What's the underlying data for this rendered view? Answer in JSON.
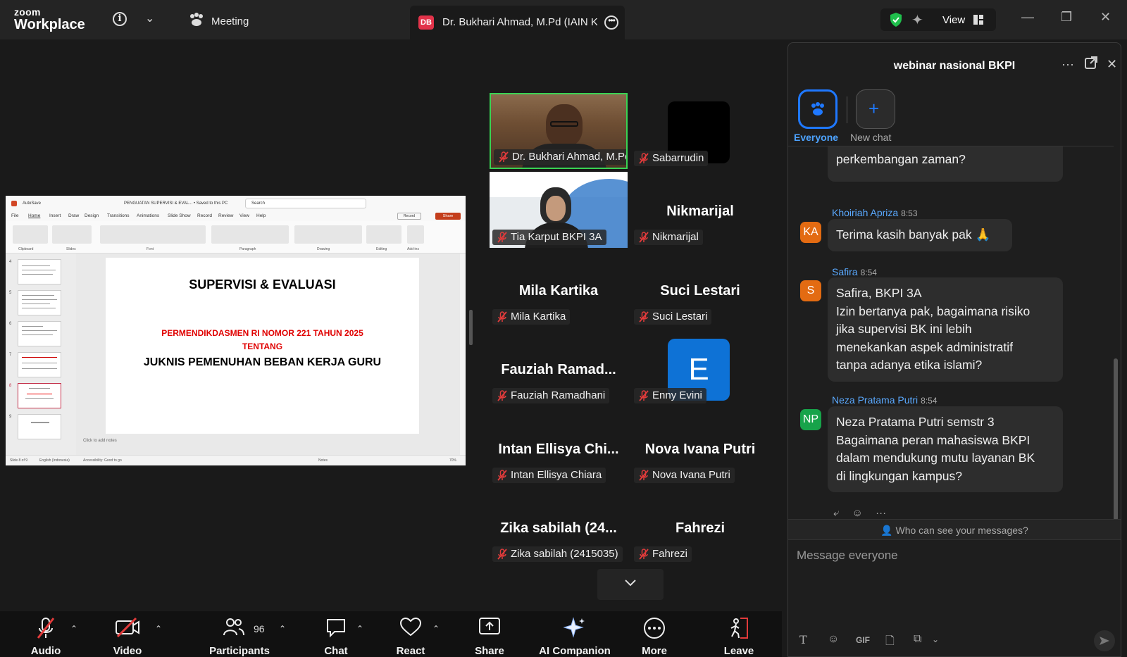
{
  "app": {
    "brand_top": "zoom",
    "brand_bottom": "Workplace",
    "meeting_label": "Meeting",
    "view_label": "View"
  },
  "active_tab": {
    "initials": "DB",
    "title": "Dr. Bukhari Ahmad, M.Pd (IAIN Ke"
  },
  "shared_screen": {
    "autosave": "AutoSave",
    "doc_title": "PENGUATAN SUPERVISI & EVAL... • Saved to this PC",
    "search_placeholder": "Search",
    "menu": [
      "File",
      "Home",
      "Insert",
      "Draw",
      "Design",
      "Transitions",
      "Animations",
      "Slide Show",
      "Record",
      "Review",
      "View",
      "Help"
    ],
    "record": "Record",
    "share": "Share",
    "ribbon_groups": [
      "Clipboard",
      "Slides",
      "Font",
      "Paragraph",
      "Drawing",
      "Editing",
      "Add-ins"
    ],
    "thumb_numbers": [
      "4",
      "5",
      "6",
      "7",
      "8",
      "9"
    ],
    "slide": {
      "title": "SUPERVISI & EVALUASI",
      "red_line1": "PERMENDIKDASMEN RI NOMOR 221 TAHUN 2025",
      "red_line2": "TENTANG",
      "subtitle": "JUKNIS PEMENUHAN BEBAN KERJA GURU"
    },
    "notes": "Click to add notes",
    "status_slide": "Slide 8 of 9",
    "status_lang": "English (Indonesia)",
    "status_access": "Accessibility: Good to go",
    "status_notes": "Notes",
    "zoom_pct": "70%"
  },
  "gallery": [
    {
      "label": "Dr. Bukhari Ahmad, M.Pd ...",
      "big": "",
      "kind": "video-a"
    },
    {
      "label": "Sabarrudin",
      "big": "",
      "kind": "black"
    },
    {
      "label": "Tia Karput BKPI 3A",
      "big": "",
      "kind": "video-b"
    },
    {
      "label": "Nikmarijal",
      "big": "Nikmarijal",
      "kind": "name"
    },
    {
      "label": "Mila Kartika",
      "big": "Mila Kartika",
      "kind": "name"
    },
    {
      "label": "Suci Lestari",
      "big": "Suci Lestari",
      "kind": "name"
    },
    {
      "label": "Fauziah Ramadhani",
      "big": "Fauziah  Ramad...",
      "kind": "name"
    },
    {
      "label": "Enny Evini",
      "big": "E",
      "kind": "letter"
    },
    {
      "label": "Intan Ellisya Chiara",
      "big": "Intan  Ellisya  Chi...",
      "kind": "name"
    },
    {
      "label": "Nova Ivana Putri",
      "big": "Nova Ivana Putri",
      "kind": "name"
    },
    {
      "label": "Zika sabilah (2415035)",
      "big": "Zika  sabilah  (24...",
      "kind": "name"
    },
    {
      "label": "Fahrezi",
      "big": "Fahrezi",
      "kind": "name"
    }
  ],
  "chat": {
    "title": "webinar nasional BKPI",
    "channels": {
      "everyone": "Everyone",
      "new_chat": "New chat"
    },
    "partial_message": "perkembangan zaman?",
    "messages": [
      {
        "initials": "KA",
        "sender": "Khoiriah Apriza",
        "time": "8:53",
        "lines": [
          "Terima kasih banyak pak 🙏"
        ],
        "color": "#e36b12"
      },
      {
        "initials": "S",
        "sender": "Safira",
        "time": "8:54",
        "lines": [
          "Safira, BKPI 3A",
          "Izin bertanya pak, bagaimana risiko",
          "jika supervisi BK ini lebih",
          "menekankan aspek administratif",
          "tanpa adanya etika islami?"
        ],
        "color": "#e36b12"
      },
      {
        "initials": "NP",
        "sender": "Neza Pratama Putri",
        "time": "8:54",
        "lines": [
          "Neza Pratama Putri semstr 3",
          "Bagaimana peran mahasiswa BKPI",
          "dalam mendukung mutu layanan BK",
          "di lingkungan kampus?"
        ],
        "color": "#17a34a"
      }
    ],
    "who_can_see": "Who can see your messages?",
    "compose_placeholder": "Message everyone",
    "gif": "GIF"
  },
  "toolbar": {
    "audio": "Audio",
    "video": "Video",
    "participants": "Participants",
    "participants_count": "96",
    "chat": "Chat",
    "react": "React",
    "share": "Share",
    "ai": "AI Companion",
    "more": "More",
    "leave": "Leave"
  }
}
